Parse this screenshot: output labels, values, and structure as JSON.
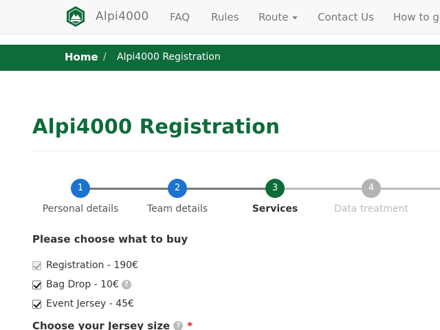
{
  "navbar": {
    "brand": "Alpi4000",
    "items": [
      {
        "label": "FAQ"
      },
      {
        "label": "Rules"
      },
      {
        "label": "Route"
      },
      {
        "label": "Contact Us"
      },
      {
        "label": "How to ge"
      }
    ]
  },
  "breadcrumb": {
    "home": "Home",
    "separator": "/",
    "current": "Alpi4000 Registration"
  },
  "page": {
    "title": "Alpi4000 Registration"
  },
  "stepper": {
    "steps": [
      {
        "number": "1",
        "label": "Personal details",
        "state": "done"
      },
      {
        "number": "2",
        "label": "Team details",
        "state": "done"
      },
      {
        "number": "3",
        "label": "Services",
        "state": "active"
      },
      {
        "number": "4",
        "label": "Data treatment",
        "state": "pending"
      }
    ]
  },
  "form": {
    "buy_heading": "Please choose what to buy",
    "options": [
      {
        "label": "Registration - 190€",
        "checked": true,
        "disabled": true
      },
      {
        "label": "Bag Drop - 10€",
        "checked": true,
        "disabled": false,
        "help": "?"
      },
      {
        "label": "Event Jersey - 45€",
        "checked": true,
        "disabled": false
      }
    ],
    "jersey_heading": "Choose your Jersey size",
    "jersey_help": "?",
    "required_mark": "*"
  },
  "colors": {
    "brand_green": "#0e6b3a",
    "step_done": "#1a73d0",
    "step_active": "#0e6b3a",
    "step_pending": "#b3b3b3",
    "required": "#d9221c"
  }
}
